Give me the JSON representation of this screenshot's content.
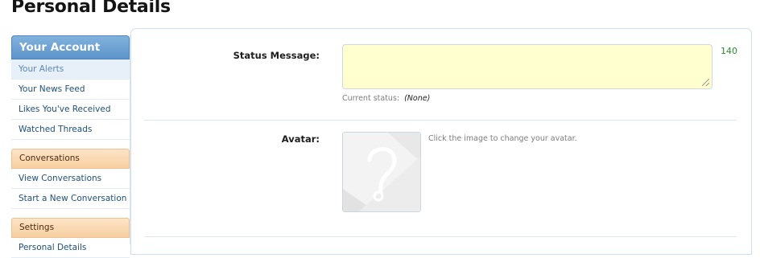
{
  "page": {
    "title": "Personal Details"
  },
  "sidebar": {
    "account_header": "Your Account",
    "account_items": [
      {
        "label": "Your Alerts"
      },
      {
        "label": "Your News Feed"
      },
      {
        "label": "Likes You've Received"
      },
      {
        "label": "Watched Threads"
      }
    ],
    "conversations_header": "Conversations",
    "conversation_items": [
      {
        "label": "View Conversations"
      },
      {
        "label": "Start a New Conversation"
      }
    ],
    "settings_header": "Settings",
    "settings_items": [
      {
        "label": "Personal Details"
      }
    ]
  },
  "form": {
    "status_label": "Status Message:",
    "status_value": "",
    "char_count": "140",
    "current_status_label": "Current status:",
    "current_status_value": "(None)",
    "avatar_label": "Avatar:",
    "avatar_hint": "Click the image to change your avatar."
  },
  "colors": {
    "sidebar_header": "#5d94c9",
    "section_header": "#f7cfa1",
    "status_box": "#ffffcf",
    "char_count": "#2f8a2f"
  }
}
